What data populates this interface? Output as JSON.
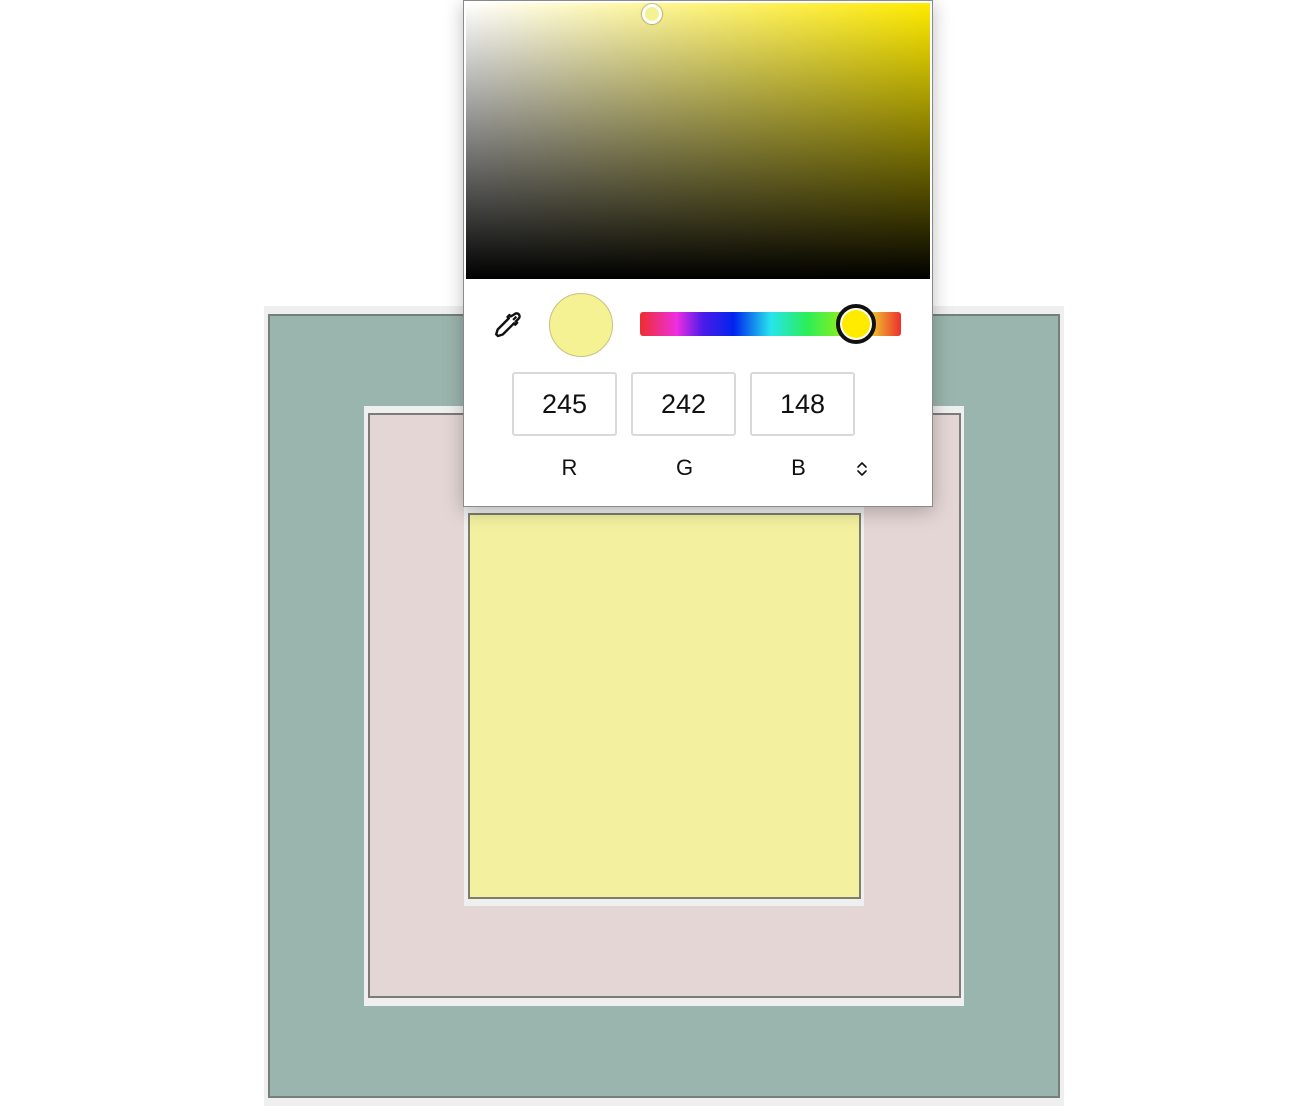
{
  "swatches": {
    "outer_color": "#9ab5ad",
    "middle_color": "#e3d6d4",
    "inner_color": "#f3f19f"
  },
  "picker": {
    "hue_color": "#ffeb00",
    "selected_color": "#f5f294",
    "hue_degrees": 58,
    "saturation": 0.4,
    "value": 0.96,
    "eyedropper_icon": "eyedropper-icon",
    "mode_toggle_icon": "chevron-up-down-icon",
    "channels": [
      {
        "value": "245",
        "label": "R"
      },
      {
        "value": "242",
        "label": "G"
      },
      {
        "value": "148",
        "label": "B"
      }
    ]
  }
}
